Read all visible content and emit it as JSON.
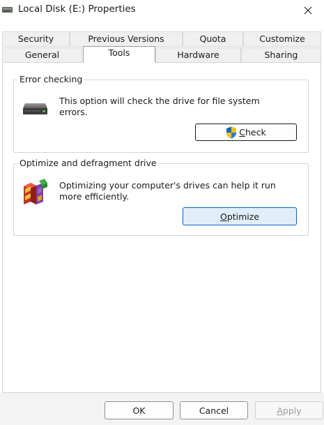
{
  "window": {
    "title": "Local Disk (E:) Properties",
    "icons": {
      "drive": "drive-icon",
      "close": "close-icon"
    }
  },
  "tabs": {
    "row1": [
      "Security",
      "Previous Versions",
      "Quota",
      "Customize"
    ],
    "row2": [
      "General",
      "Tools",
      "Hardware",
      "Sharing"
    ],
    "active": "Tools"
  },
  "error_checking": {
    "title": "Error checking",
    "description": "This option will check the drive for file system errors.",
    "button": {
      "prefix": "",
      "accel": "C",
      "suffix": "heck",
      "icon": "uac-shield-icon"
    },
    "icon": "hard-drive-icon"
  },
  "optimize": {
    "title": "Optimize and defragment drive",
    "description": "Optimizing your computer's drives can help it run more efficiently.",
    "button": {
      "prefix": "",
      "accel": "O",
      "suffix": "ptimize"
    },
    "icon": "defrag-blocks-icon"
  },
  "footer": {
    "ok": "OK",
    "cancel": "Cancel",
    "apply": "Apply",
    "apply_accel": "A",
    "apply_rest": "pply"
  },
  "colors": {
    "accent": "#0067c0",
    "primary_button_bg": "#e0eef9",
    "disabled_text": "#9d9d9d"
  }
}
